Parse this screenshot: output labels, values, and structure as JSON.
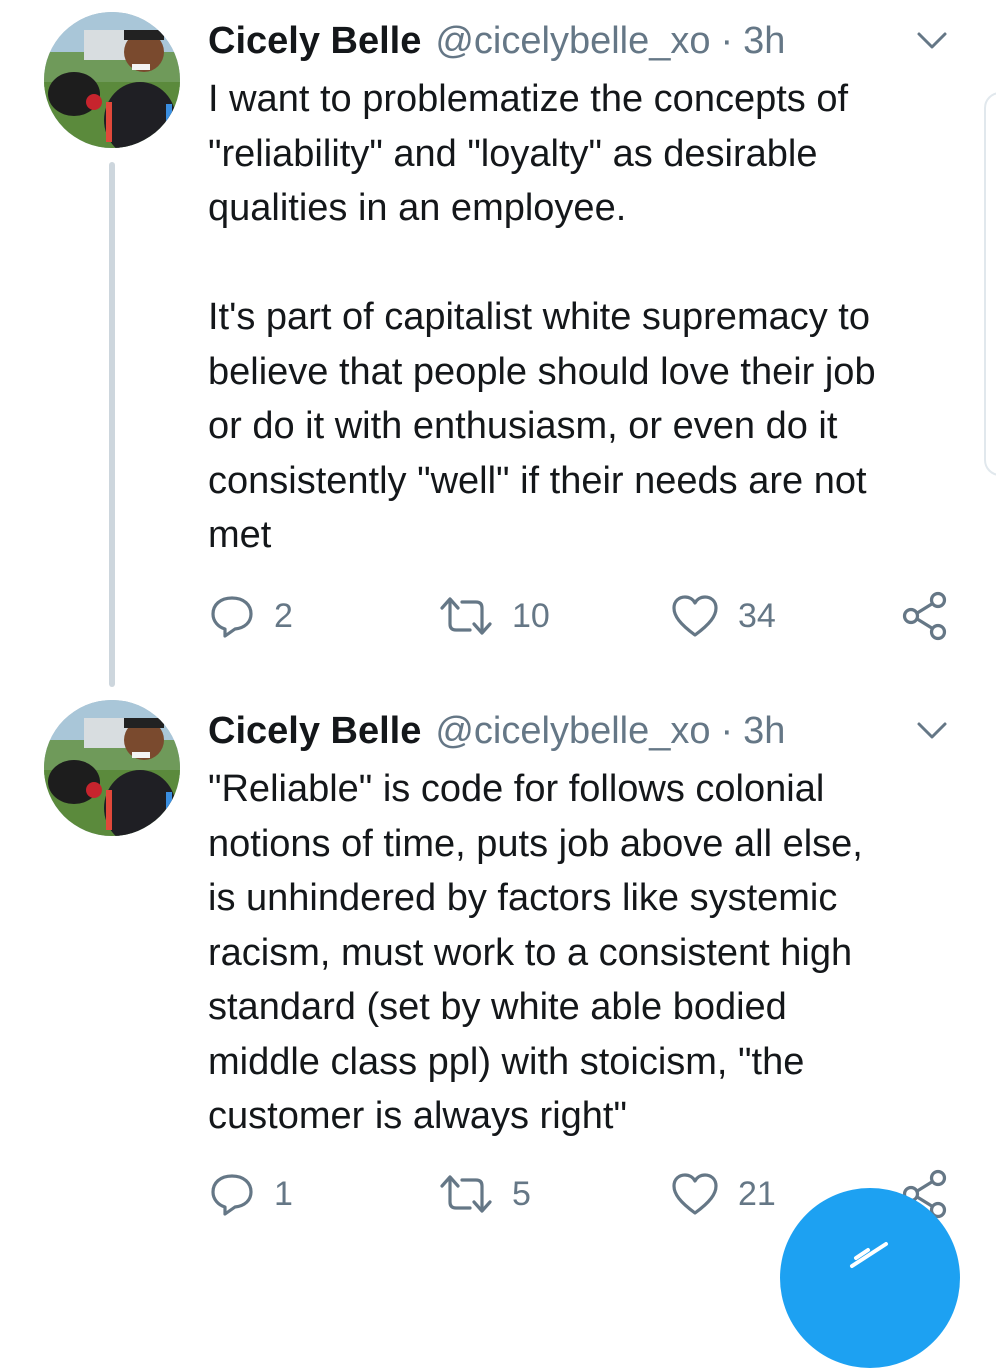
{
  "tweets": [
    {
      "author_name": "Cicely Belle",
      "handle": "@cicelybelle_xo",
      "separator": "·",
      "time": "3h",
      "paragraphs": [
        "I want to problematize the concepts of\n\"reliability\" and \"loyalty\" as desirable\nqualities in an employee.",
        "It's part of capitalist white supremacy to\nbelieve that people should love their job\nor do it with enthusiasm, or even do it\nconsistently \"well\" if their needs are not\nmet"
      ],
      "replies": "2",
      "retweets": "10",
      "likes": "34",
      "icons": {
        "reply": "reply-icon",
        "retweet": "retweet-icon",
        "like": "heart-icon",
        "share": "share-icon",
        "menu": "chevron-down-icon"
      }
    },
    {
      "author_name": "Cicely Belle",
      "handle": "@cicelybelle_xo",
      "separator": "·",
      "time": "3h",
      "paragraphs": [
        "\"Reliable\" is code for follows colonial\nnotions of time, puts job above all else,\nis unhindered by factors like systemic\nracism, must work to a consistent high\nstandard (set by white able bodied\nmiddle class ppl) with stoicism, \"the\ncustomer is always right\""
      ],
      "replies": "1",
      "retweets": "5",
      "likes": "21",
      "icons": {
        "reply": "reply-icon",
        "retweet": "retweet-icon",
        "like": "heart-icon",
        "share": "share-icon",
        "menu": "chevron-down-icon"
      }
    }
  ],
  "colors": {
    "primary_text": "#14171a",
    "secondary_text": "#657786",
    "thread_line": "#cdd6dd",
    "accent": "#1da1f2"
  },
  "compose_button": {
    "icon": "compose-icon"
  }
}
